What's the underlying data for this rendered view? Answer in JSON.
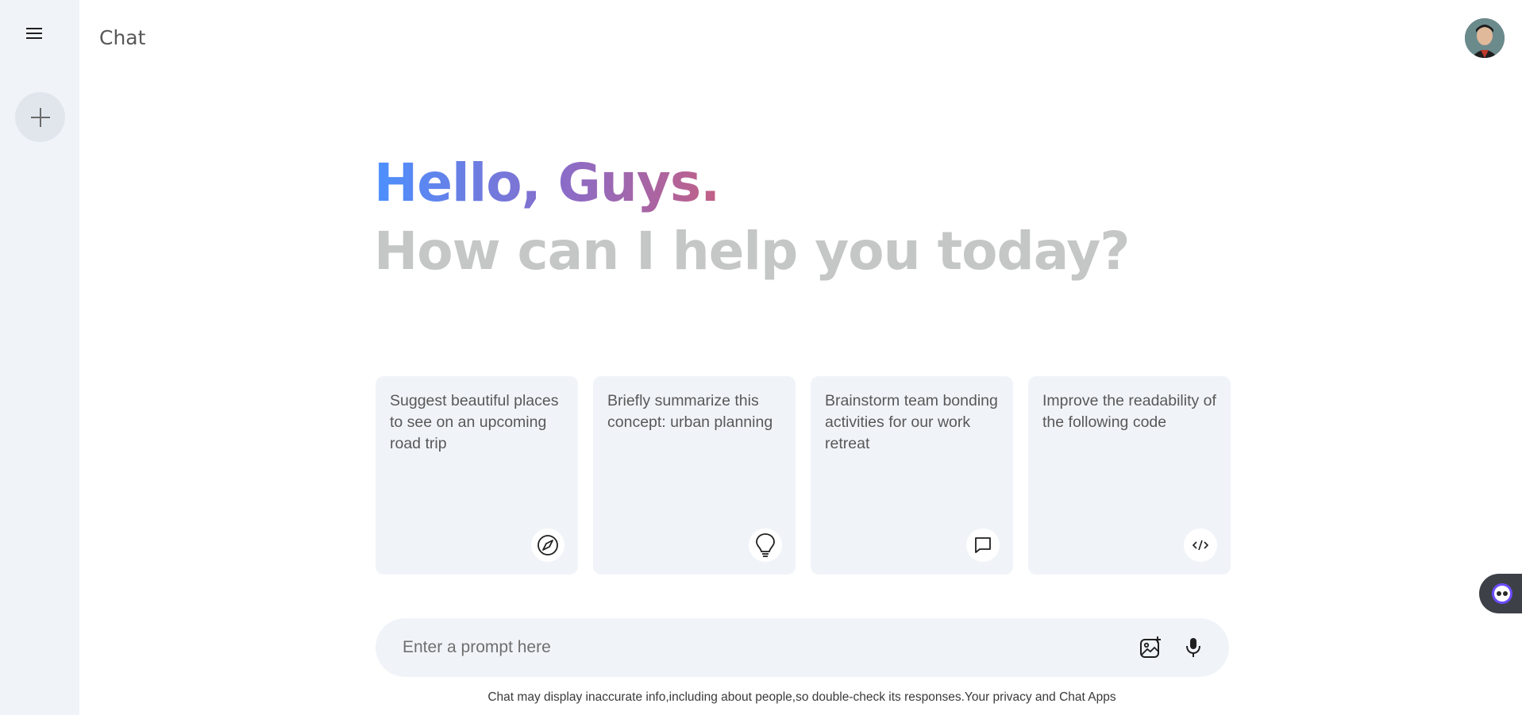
{
  "header": {
    "title": "Chat"
  },
  "greeting": {
    "line1": "Hello, Guys.",
    "line2": "How can I help you today?"
  },
  "cards": [
    {
      "text": "Suggest beautiful places to see on an upcoming road trip",
      "icon": "compass-icon"
    },
    {
      "text": "Briefly summarize this concept: urban planning",
      "icon": "bulb-icon"
    },
    {
      "text": "Brainstorm team bonding activities for our work retreat",
      "icon": "message-icon"
    },
    {
      "text": "Improve the readability of the following code",
      "icon": "code-icon"
    }
  ],
  "prompt": {
    "placeholder": "Enter a prompt here",
    "icons": [
      "gallery-icon",
      "mic-icon"
    ]
  },
  "footer": {
    "disclaimer": "Chat may display inaccurate info,including about people,so double-check its responses.Your privacy and Chat Apps"
  },
  "sidebar": {
    "icons": [
      "menu-icon",
      "plus-icon"
    ]
  },
  "colors": {
    "accent_start": "#4b90ff",
    "accent_end": "#ff5546",
    "surface": "#f0f4f9"
  }
}
